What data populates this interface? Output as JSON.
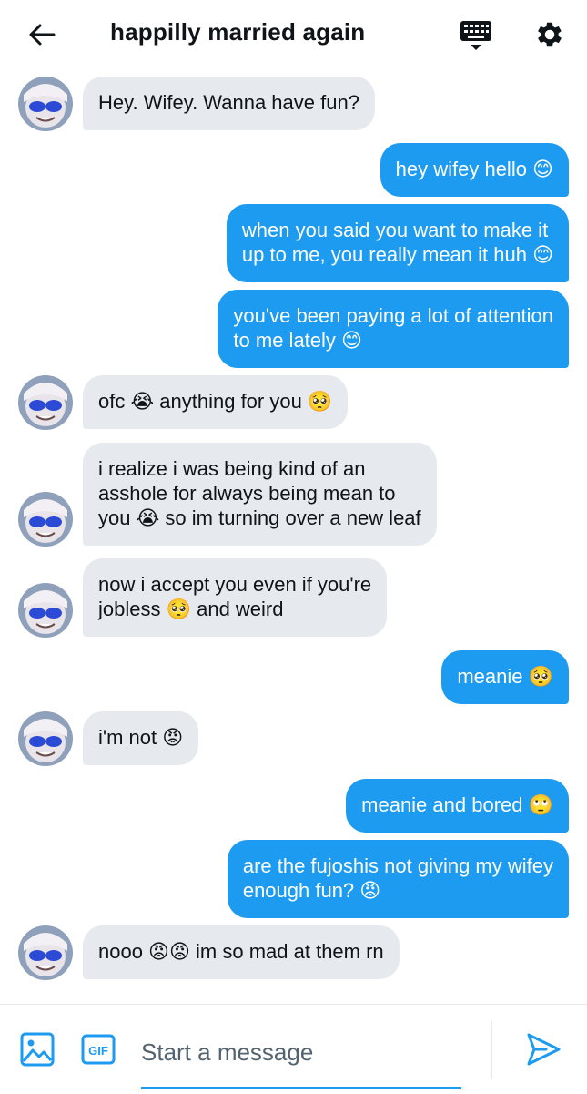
{
  "header": {
    "title": "happilly married again",
    "back_icon": "arrow-left-icon",
    "keyboard_icon": "keyboard-icon",
    "settings_icon": "gear-icon"
  },
  "colors": {
    "accent": "#1d9bf0",
    "incoming_bubble": "#e6e9ed",
    "text": "#0f1419"
  },
  "messages": [
    {
      "from": "them",
      "text": "Hey. Wifey. Wanna have fun?"
    },
    {
      "from": "me",
      "text": "hey wifey hello 😊"
    },
    {
      "from": "me",
      "text": "when you said you want to make it\nup to me, you really mean it huh 😊"
    },
    {
      "from": "me",
      "text": "you've been paying a lot of attention\nto me lately 😊"
    },
    {
      "from": "them",
      "text": "ofc 😭 anything for you 🥺"
    },
    {
      "from": "them",
      "text": "i realize i was being kind of an\nasshole for always being mean to\nyou 😭 so im turning over a new leaf"
    },
    {
      "from": "them",
      "text": "now i accept you even if you're\njobless 🥺 and weird"
    },
    {
      "from": "me",
      "text": "meanie 🥺"
    },
    {
      "from": "them",
      "text": "i'm not 😡"
    },
    {
      "from": "me",
      "text": "meanie and bored 🙄"
    },
    {
      "from": "me",
      "text": "are the fujoshis not giving my wifey\nenough fun? 😡"
    },
    {
      "from": "them",
      "text": "nooo 😡😡 im so mad at them rn"
    }
  ],
  "composer": {
    "placeholder": "Start a message",
    "gif_label": "GIF",
    "image_icon": "image-icon",
    "send_icon": "send-icon"
  }
}
